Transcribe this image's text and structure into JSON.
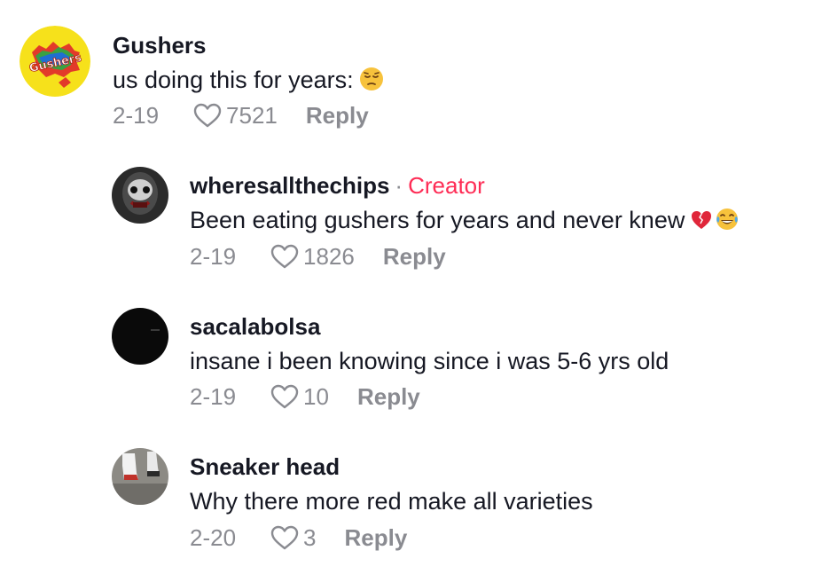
{
  "comments": [
    {
      "username": "Gushers",
      "text": "us doing this for years:",
      "emoji": "pensive-face",
      "date": "2-19",
      "likes": "7521",
      "reply_label": "Reply",
      "avatar_logo_text": "Gushers"
    },
    {
      "username": "wheresallthechips",
      "creator_separator": "·",
      "creator_label": "Creator",
      "text": "Been eating gushers for years and never knew",
      "emoji": [
        "broken-heart",
        "tears-of-joy-face"
      ],
      "date": "2-19",
      "likes": "1826",
      "reply_label": "Reply"
    },
    {
      "username": "sacalabolsa",
      "text": "insane i been knowing since i was 5-6 yrs old",
      "date": "2-19",
      "likes": "10",
      "reply_label": "Reply"
    },
    {
      "username": "Sneaker head",
      "text": "Why there more red make all varieties",
      "date": "2-20",
      "likes": "3",
      "reply_label": "Reply"
    }
  ],
  "colors": {
    "text_primary": "#161823",
    "text_secondary": "#8a8b91",
    "creator_accent": "#fe2c55"
  }
}
